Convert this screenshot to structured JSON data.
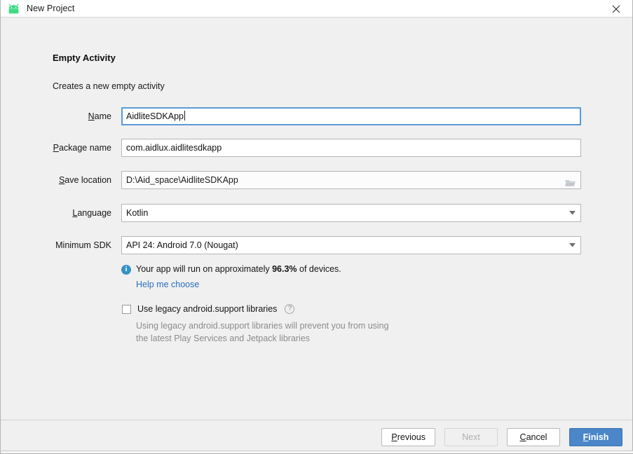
{
  "window": {
    "title": "New Project",
    "app_icon": "android-robot-icon",
    "close_icon": "close-icon"
  },
  "header": {
    "title": "Empty Activity",
    "subtitle": "Creates a new empty activity"
  },
  "form": {
    "fields": [
      {
        "label": "Name",
        "mnemonic": "N",
        "value": "AidliteSDKApp",
        "type": "text",
        "focused": true
      },
      {
        "label": "Package name",
        "mnemonic": "P",
        "value": "com.aidlux.aidlitesdkapp",
        "type": "text",
        "focused": false
      },
      {
        "label": "Save location",
        "mnemonic": "S",
        "value": "D:\\Aid_space\\AidliteSDKApp",
        "type": "path",
        "focused": false,
        "trailing_icon": "folder-browse-icon"
      },
      {
        "label": "Language",
        "mnemonic": "L",
        "value": "Kotlin",
        "type": "combo",
        "focused": false,
        "trailing_icon": "chevron-down-icon"
      },
      {
        "label": "Minimum SDK",
        "mnemonic": "",
        "value": "API 24: Android 7.0 (Nougat)",
        "type": "combo",
        "focused": false,
        "trailing_icon": "chevron-down-icon"
      }
    ]
  },
  "info": {
    "icon": "info-icon",
    "text_before": "Your app will run on approximately ",
    "percent": "96.3%",
    "text_after": " of devices.",
    "link_label": "Help me choose"
  },
  "legacy": {
    "checkbox_label": "Use legacy android.support libraries",
    "checked": false,
    "help_icon": "question-mark-icon",
    "description_line1": "Using legacy android.support libraries will prevent you from using",
    "description_line2": "the latest Play Services and Jetpack libraries"
  },
  "footer": {
    "buttons": [
      {
        "label": "Previous",
        "mnemonic": "P",
        "state": "enabled",
        "primary": false
      },
      {
        "label": "Next",
        "mnemonic": "",
        "state": "disabled",
        "primary": false
      },
      {
        "label": "Cancel",
        "mnemonic": "C",
        "state": "enabled",
        "primary": false
      },
      {
        "label": "Finish",
        "mnemonic": "F",
        "state": "enabled",
        "primary": true
      }
    ]
  },
  "colors": {
    "accent_blue": "#4a86c8",
    "focus_border": "#5b9bd5",
    "link_blue": "#2a6ebb",
    "info_blue": "#3592c4",
    "android_green": "#3ddc84",
    "dialog_bg": "#f0f0f0"
  }
}
